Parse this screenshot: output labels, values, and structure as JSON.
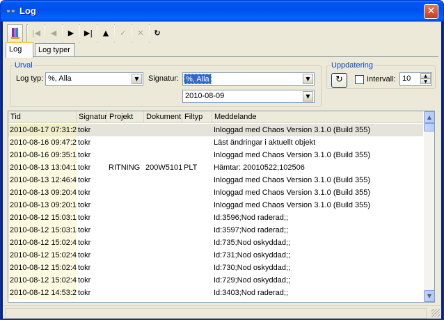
{
  "window": {
    "title": "Log",
    "close_glyph": "✕",
    "title_icon": "glasses-icon"
  },
  "toolbar": [
    {
      "name": "user-icon-button",
      "glyph": "",
      "enabled": true
    },
    {
      "name": "first-button",
      "glyph": "|◀",
      "enabled": false
    },
    {
      "name": "prev-button",
      "glyph": "◀",
      "enabled": false
    },
    {
      "name": "next-button",
      "glyph": "▶",
      "enabled": true
    },
    {
      "name": "last-button",
      "glyph": "▶|",
      "enabled": true
    },
    {
      "name": "up-button",
      "glyph": "▲",
      "enabled": true
    },
    {
      "name": "check-button",
      "glyph": "✓",
      "enabled": false
    },
    {
      "name": "delete-button",
      "glyph": "✕",
      "enabled": false
    },
    {
      "name": "refresh-button",
      "glyph": "↻",
      "enabled": true
    }
  ],
  "tabs": [
    {
      "label": "Log",
      "active": true
    },
    {
      "label": "Log typer",
      "active": false
    }
  ],
  "filter": {
    "group_label": "Urval",
    "logtyp_label": "Log typ:",
    "logtyp_value": "%,  Alla",
    "signatur_label": "Signatur:",
    "signatur_value": "%, Alla",
    "date_value": "2010-08-09"
  },
  "update": {
    "group_label": "Uppdatering",
    "refresh_glyph": "↻",
    "interval_label": "Intervall:",
    "interval_checked": false,
    "interval_value": "10"
  },
  "grid": {
    "columns": [
      "Tid",
      "Signatur",
      "Projekt",
      "Dokument",
      "Filtyp",
      "Meddelande"
    ],
    "rows": [
      {
        "tid": "2010-08-17 07:31:2",
        "signatur": "tokr",
        "projekt": "",
        "dokument": "",
        "filtyp": "",
        "meddelande": "Inloggad med Chaos Version 3.1.0 (Build 355)"
      },
      {
        "tid": "2010-08-16 09:47:2",
        "signatur": "tokr",
        "projekt": "",
        "dokument": "",
        "filtyp": "",
        "meddelande": "Läst ändringar i aktuellt objekt"
      },
      {
        "tid": "2010-08-16 09:35:1",
        "signatur": "tokr",
        "projekt": "",
        "dokument": "",
        "filtyp": "",
        "meddelande": "Inloggad med Chaos Version 3.1.0 (Build 355)"
      },
      {
        "tid": "2010-08-13 13:04:1",
        "signatur": "tokr",
        "projekt": "RITNING",
        "dokument": "200W5101",
        "filtyp": "PLT",
        "meddelande": "Hämtar: 20010522;102506"
      },
      {
        "tid": "2010-08-13 12:46:4",
        "signatur": "tokr",
        "projekt": "",
        "dokument": "",
        "filtyp": "",
        "meddelande": "Inloggad med Chaos Version 3.1.0 (Build 355)"
      },
      {
        "tid": "2010-08-13 09:20:4",
        "signatur": "tokr",
        "projekt": "",
        "dokument": "",
        "filtyp": "",
        "meddelande": "Inloggad med Chaos Version 3.1.0 (Build 355)"
      },
      {
        "tid": "2010-08-13 09:20:1",
        "signatur": "tokr",
        "projekt": "",
        "dokument": "",
        "filtyp": "",
        "meddelande": "Inloggad med Chaos Version 3.1.0 (Build 355)"
      },
      {
        "tid": "2010-08-12 15:03:1",
        "signatur": "tokr",
        "projekt": "",
        "dokument": "",
        "filtyp": "",
        "meddelande": "Id:3596;Nod raderad;;"
      },
      {
        "tid": "2010-08-12 15:03:1",
        "signatur": "tokr",
        "projekt": "",
        "dokument": "",
        "filtyp": "",
        "meddelande": "Id:3597;Nod raderad;;"
      },
      {
        "tid": "2010-08-12 15:02:4",
        "signatur": "tokr",
        "projekt": "",
        "dokument": "",
        "filtyp": "",
        "meddelande": "Id:735;Nod oskyddad;;"
      },
      {
        "tid": "2010-08-12 15:02:4",
        "signatur": "tokr",
        "projekt": "",
        "dokument": "",
        "filtyp": "",
        "meddelande": "Id:731;Nod oskyddad;;"
      },
      {
        "tid": "2010-08-12 15:02:4",
        "signatur": "tokr",
        "projekt": "",
        "dokument": "",
        "filtyp": "",
        "meddelande": "Id:730;Nod oskyddad;;"
      },
      {
        "tid": "2010-08-12 15:02:4",
        "signatur": "tokr",
        "projekt": "",
        "dokument": "",
        "filtyp": "",
        "meddelande": "Id:729;Nod oskyddad;;"
      },
      {
        "tid": "2010-08-12 14:53:2",
        "signatur": "tokr",
        "projekt": "",
        "dokument": "",
        "filtyp": "",
        "meddelande": "Id:3403;Nod raderad;;"
      }
    ]
  },
  "colors": {
    "title_bar": "#0053ee",
    "selection": "#316ac5",
    "tid_column": "#fbfae0",
    "legend_text": "#0046d5"
  }
}
